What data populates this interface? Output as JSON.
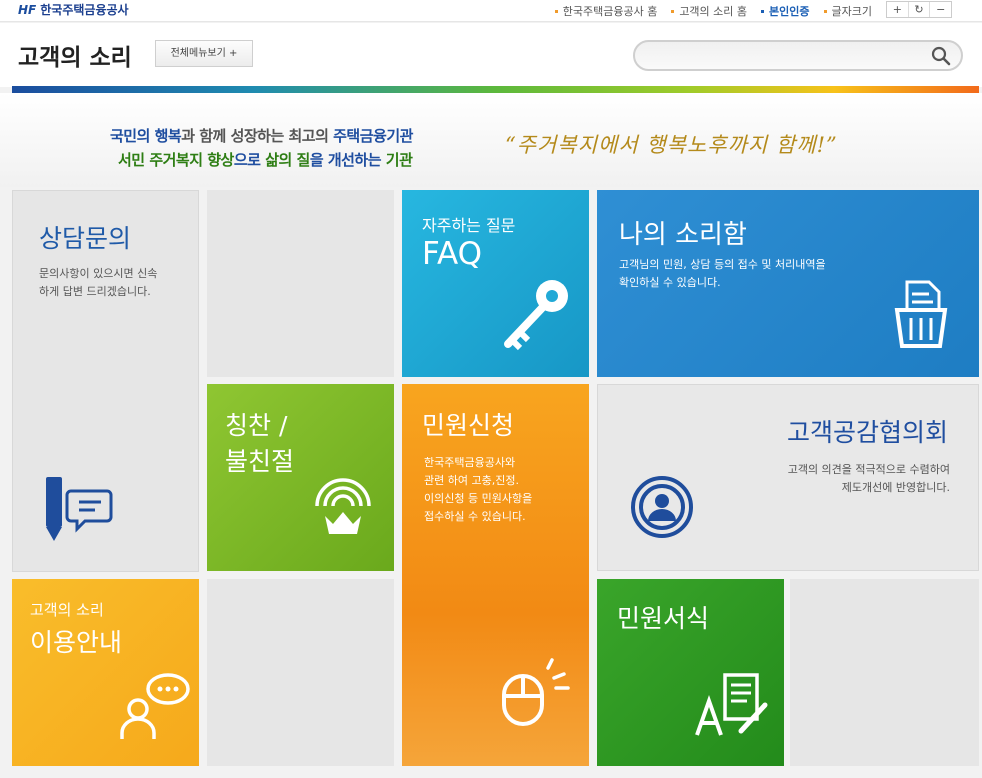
{
  "topbar": {
    "logo_mark": "HF",
    "logo_text": "한국주택금융공사",
    "links": [
      {
        "label": "한국주택금융공사 홈"
      },
      {
        "label": "고객의 소리 홈"
      },
      {
        "label": "본인인증"
      },
      {
        "label": "글자크기"
      }
    ],
    "font_controls": [
      "+",
      "↻",
      "−"
    ]
  },
  "header": {
    "title": "고객의 소리",
    "all_menu_label": "전체메뉴보기 +",
    "search_placeholder": ""
  },
  "slogan": {
    "line1": {
      "a": "국민의 행복",
      "b": "과 함께 성장하는 최고의 ",
      "c": "주택금융기관"
    },
    "line2": {
      "a": "서민 주거복지 향상",
      "b": "으로 ",
      "c": "삶의 질",
      "d": "을 개선하는 ",
      "e": "기관"
    },
    "quote": "“주거복지에서 행복노후까지 함께!”"
  },
  "tiles": {
    "consult": {
      "title": "상담문의",
      "desc1": "문의사항이 있으시면 신속",
      "desc2": "하게 답변 드리겠습니다."
    },
    "faq": {
      "subtitle": "자주하는 질문",
      "title": "FAQ"
    },
    "mybox": {
      "title": "나의 소리함",
      "desc1": "고객님의 민원, 상담 등의 접수 및 처리내역을",
      "desc2": "확인하실 수 있습니다."
    },
    "praise": {
      "title1": "칭찬 /",
      "title2": "불친절"
    },
    "apply": {
      "title": "민원신청",
      "desc1": "한국주택금융공사와",
      "desc2": "관련 하여 고충,진정.",
      "desc3": "이의신청 등 민원사항을",
      "desc4": "접수하실 수 있습니다."
    },
    "council": {
      "title": "고객공감협의회",
      "desc1": "고객의 의견을 적극적으로 수렴하여",
      "desc2": "제도개선에 반영합니다."
    },
    "guide": {
      "subtitle": "고객의 소리",
      "title": "이용안내"
    },
    "forms": {
      "title": "민원서식"
    }
  }
}
